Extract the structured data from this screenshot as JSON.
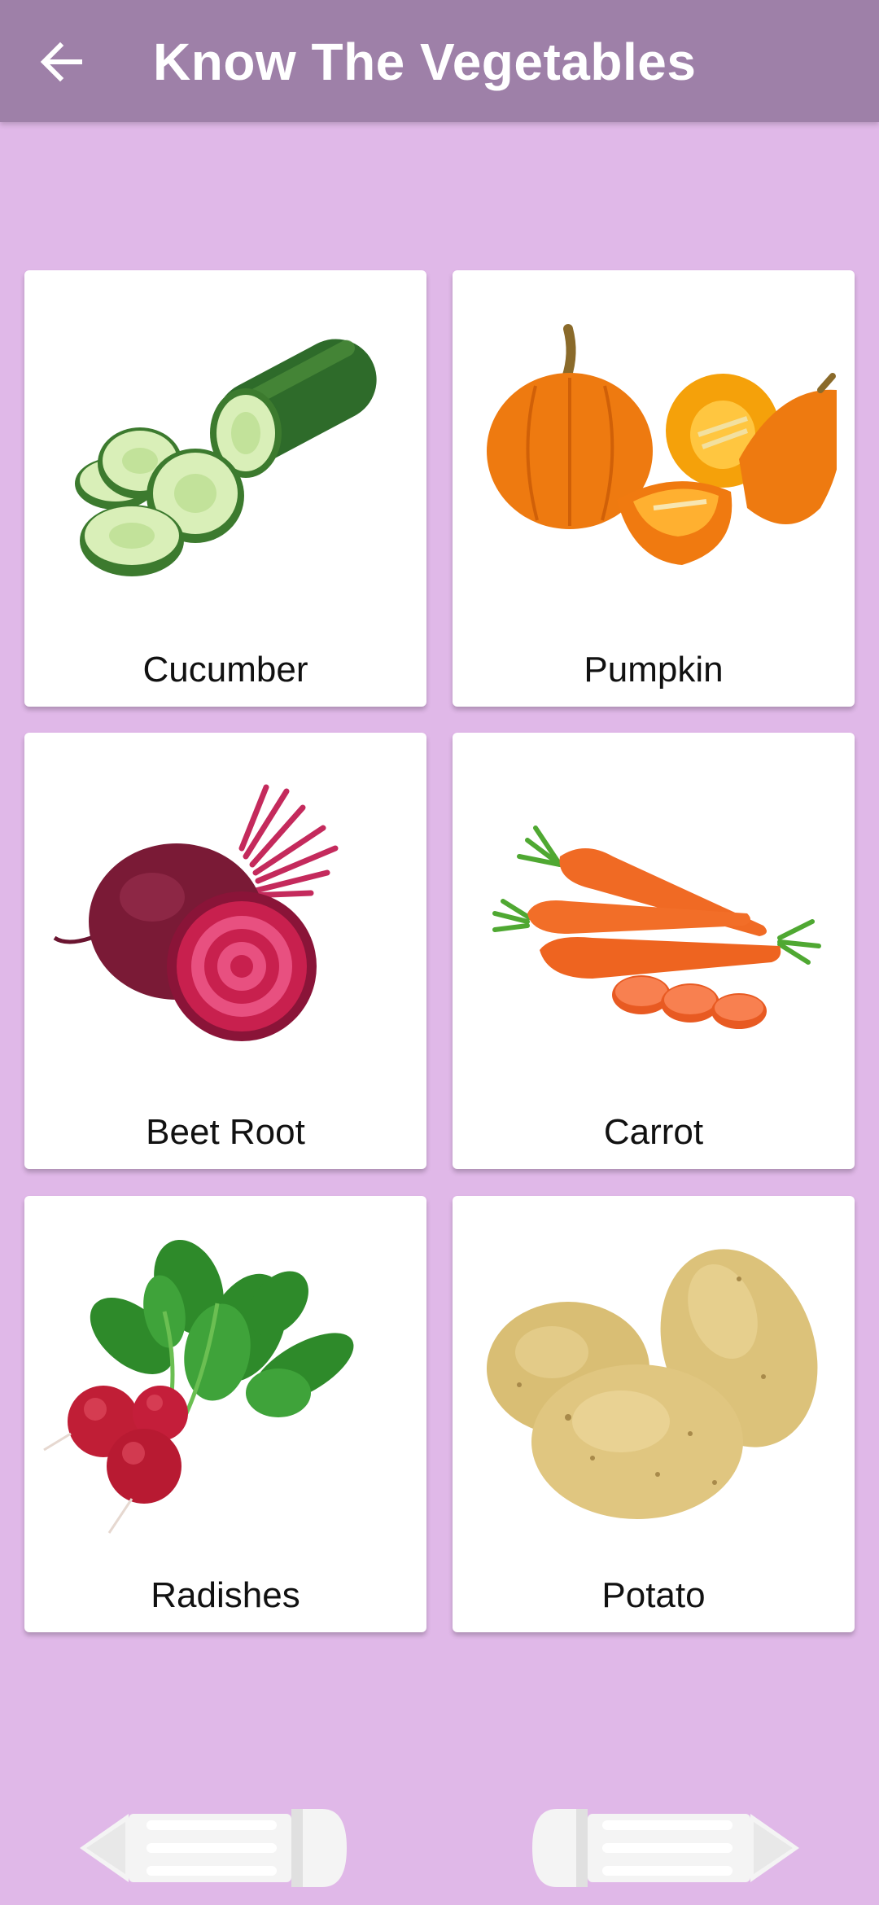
{
  "appbar": {
    "title": "Know The Vegetables",
    "back_icon": "arrow-left-icon"
  },
  "colors": {
    "background": "#E0B8E8",
    "appbar": "#9E80A8",
    "card": "#FFFFFF",
    "nav_button": "#F4F4F4"
  },
  "vegetables": [
    {
      "label": "Cucumber",
      "image": "cucumber-image"
    },
    {
      "label": "Pumpkin",
      "image": "pumpkin-image"
    },
    {
      "label": "Beet Root",
      "image": "beetroot-image"
    },
    {
      "label": "Carrot",
      "image": "carrot-image"
    },
    {
      "label": "Radishes",
      "image": "radishes-image"
    },
    {
      "label": "Potato",
      "image": "potato-image"
    }
  ],
  "navigation": {
    "previous_icon": "pencil-arrow-left-icon",
    "next_icon": "pencil-arrow-right-icon"
  }
}
